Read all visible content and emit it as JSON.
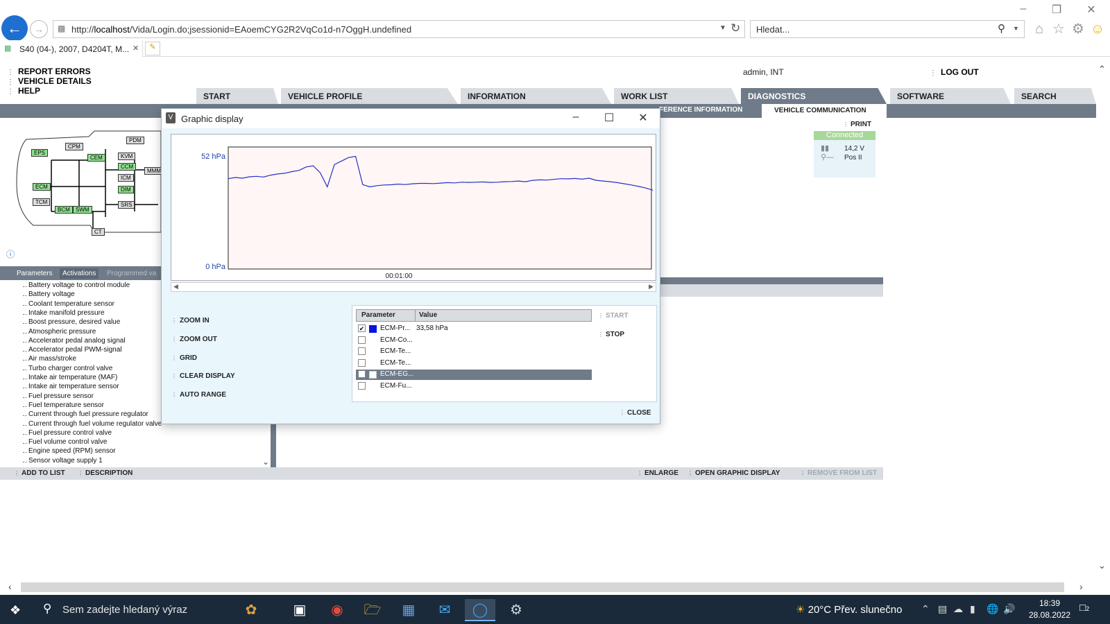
{
  "browser": {
    "url_prefix": "http://",
    "url_host": "localhost",
    "url_path": "/Vida/Login.do;jsessionid=EAoemCYG2R2VqCo1d-n7OggH.undefined",
    "search_placeholder": "Hledat...",
    "tab_title": "S40 (04-), 2007, D4204T, M...",
    "tab_close": "✕"
  },
  "app": {
    "top_links": [
      "REPORT ERRORS",
      "VEHICLE DETAILS",
      "HELP"
    ],
    "user": "admin, INT",
    "logout": "LOG OUT",
    "main_tabs": [
      "START",
      "VEHICLE PROFILE",
      "INFORMATION",
      "WORK LIST",
      "DIAGNOSTICS",
      "SOFTWARE",
      "SEARCH"
    ],
    "sub_tabs": {
      "reference": "FERENCE INFORMATION",
      "vehicle_comm": "VEHICLE COMMUNICATION"
    },
    "print": "PRINT",
    "connection": {
      "status": "Connected",
      "voltage": "14,2 V",
      "position": "Pos II"
    },
    "diagram_modules": [
      "EPS",
      "CPM",
      "PDM",
      "CEM",
      "KVM",
      "CCM",
      "MMM",
      "ICM",
      "DIM",
      "ECM",
      "TCM",
      "BCM",
      "SWM",
      "SRS",
      "CT"
    ],
    "param_tabs": [
      "Parameters",
      "Activations",
      "Programmed va"
    ],
    "parameters": [
      "Battery voltage to control module",
      "Battery voltage",
      "Coolant temperature sensor",
      "Intake manifold pressure",
      "Boost pressure, desired value",
      "Atmospheric pressure",
      "Accelerator pedal analog signal",
      "Accelerator pedal PWM-signal",
      "Air mass/stroke",
      "Turbo charger control valve",
      "Intake air temperature (MAF)",
      "Intake air temperature sensor",
      "Fuel pressure sensor",
      "Fuel temperature sensor",
      "Current through fuel pressure regulator",
      "Current through fuel volume regulator valve",
      "Fuel pressure control valve",
      "Fuel volume control valve",
      "Engine speed (RPM) sensor",
      "Sensor voltage supply 1"
    ],
    "bottom_actions": {
      "add": "ADD TO LIST",
      "description": "DESCRIPTION",
      "enlarge": "ENLARGE",
      "open_graphic": "OPEN GRAPHIC DISPLAY",
      "remove": "REMOVE FROM LIST"
    }
  },
  "dialog": {
    "title": "Graphic display",
    "app_icon_letter": "V",
    "actions": [
      "ZOOM IN",
      "ZOOM OUT",
      "GRID",
      "CLEAR DISPLAY",
      "AUTO RANGE"
    ],
    "table_headers": {
      "parameter": "Parameter",
      "value": "Value"
    },
    "rows": [
      {
        "name": "ECM-Pr...",
        "value": "33,58 hPa",
        "checked": true,
        "color": "#0a14e0"
      },
      {
        "name": "ECM-Co...",
        "value": "",
        "checked": false,
        "color": ""
      },
      {
        "name": "ECM-Te...",
        "value": "",
        "checked": false,
        "color": ""
      },
      {
        "name": "ECM-Te...",
        "value": "",
        "checked": false,
        "color": ""
      },
      {
        "name": "ECM-EG...",
        "value": "",
        "checked": false,
        "color": "",
        "selected": true
      },
      {
        "name": "ECM-Fu...",
        "value": "",
        "checked": false,
        "color": ""
      }
    ],
    "start": "START",
    "stop": "STOP",
    "close": "CLOSE"
  },
  "chart_data": {
    "type": "line",
    "y_labels": [
      "52 hPa",
      "0 hPa"
    ],
    "x_label": "00:01:00",
    "ylim": [
      0,
      52
    ],
    "series": [
      {
        "color": "#2430c8",
        "values": [
          38.5,
          39,
          38.7,
          39.3,
          39.5,
          39.2,
          40,
          40.5,
          40.8,
          41.5,
          42,
          43.5,
          44,
          41,
          35,
          44.5,
          46,
          47.5,
          48,
          36,
          35,
          35.5,
          35.8,
          35.9,
          36.2,
          36,
          36.3,
          36.5,
          36.5,
          36.4,
          36.6,
          36.8,
          36.7,
          37,
          36.9,
          37,
          37.1,
          36.9,
          37,
          37.2,
          37.3,
          37.5,
          37.2,
          37.8,
          38,
          37.9,
          38.2,
          38.5,
          38.4,
          38.6,
          38.3,
          38.7,
          37.8,
          37.5,
          37.2,
          36.8,
          36.3,
          35.8,
          35.2,
          34.5,
          33.6
        ]
      }
    ]
  },
  "taskbar": {
    "search_placeholder": "Sem zadejte hledaný výraz",
    "weather": "20°C  Přev. slunečno",
    "time": "18:39",
    "date": "28.08.2022",
    "notifications": "2"
  },
  "colors": {
    "accent": "#6f7b89",
    "connected": "#a8d79b",
    "module_green": "#8fe38f"
  }
}
